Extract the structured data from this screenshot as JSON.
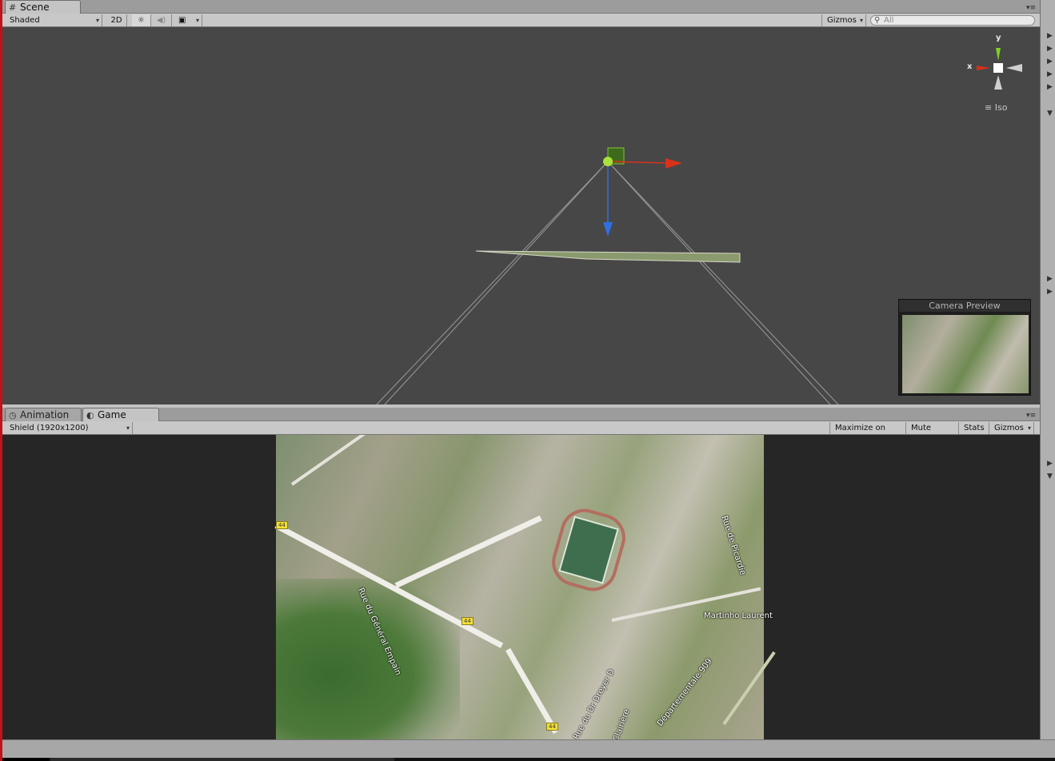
{
  "scene_tabs": {
    "scene_label": "Scene"
  },
  "scene_toolbar": {
    "shading_mode": "Shaded",
    "two_d_label": "2D",
    "gizmos_label": "Gizmos",
    "search_placeholder": "All"
  },
  "scene_gizmo": {
    "x_label": "x",
    "y_label": "y",
    "projection_label": "Iso"
  },
  "camera_preview": {
    "title": "Camera Preview"
  },
  "game_tabs": {
    "animation_label": "Animation",
    "game_label": "Game"
  },
  "game_toolbar": {
    "resolution": "Shield (1920x1200)",
    "maximize_label": "Maximize on Play",
    "mute_label": "Mute audio",
    "stats_label": "Stats",
    "gizmos_label": "Gizmos"
  },
  "map_labels": {
    "street_1": "Rue du Général Empain",
    "street_2": "Rue de Picardie",
    "street_3": "Martinho Laurent",
    "street_4": "Départementale 909",
    "street_5": "Rue du Dr Dreyer D",
    "street_6": "Clairière",
    "shield_1": "44",
    "shield_2": "44",
    "shield_3": "44"
  },
  "colors": {
    "axis_x": "#d9311c",
    "axis_y": "#7fd020",
    "axis_z": "#2f6fe0",
    "scene_bg": "#474747",
    "game_bg": "#262626",
    "window_accent": "#c0131b"
  },
  "icons": {
    "scene_tab": "grid-icon",
    "animation_tab": "clock-icon",
    "game_tab": "pacman-icon",
    "lighting": "sun-icon",
    "audio": "speaker-icon",
    "effects": "image-icon",
    "search": "search-icon"
  }
}
